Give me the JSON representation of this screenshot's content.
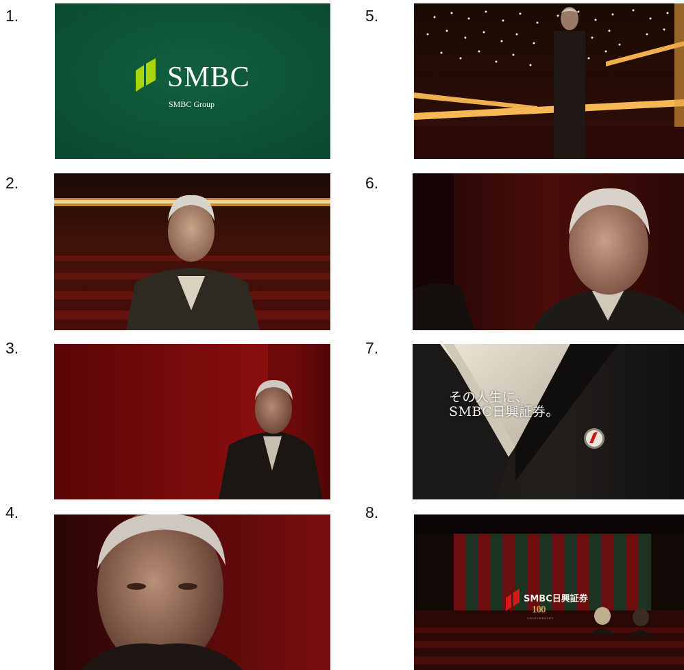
{
  "colors": {
    "smbc_green": "#0c5236",
    "smbc_lime": "#a5d50a",
    "theater_red": "#6e0d0d",
    "nikko_red": "#d41a1a"
  },
  "frames": [
    {
      "label": "1.",
      "scene": "smbc-logo-card"
    },
    {
      "label": "2.",
      "scene": "man-in-theater-seats"
    },
    {
      "label": "3.",
      "scene": "man-against-red-wall"
    },
    {
      "label": "4.",
      "scene": "close-up-portrait"
    },
    {
      "label": "5.",
      "scene": "man-on-stage-with-lights"
    },
    {
      "label": "6.",
      "scene": "smiling-man-in-audience"
    },
    {
      "label": "7.",
      "scene": "kimono-collar-with-badge"
    },
    {
      "label": "8.",
      "scene": "kabuki-curtain-with-logo"
    }
  ],
  "logo": {
    "wordmark": "SMBC",
    "group": "SMBC Group"
  },
  "frame7": {
    "line1": "その人生に、",
    "line2": "SMBC日興証券。"
  },
  "frame8": {
    "brand": "SMBC日興証券",
    "anniversary_number": "100",
    "anniversary_word": "ANNIVERSARY"
  }
}
